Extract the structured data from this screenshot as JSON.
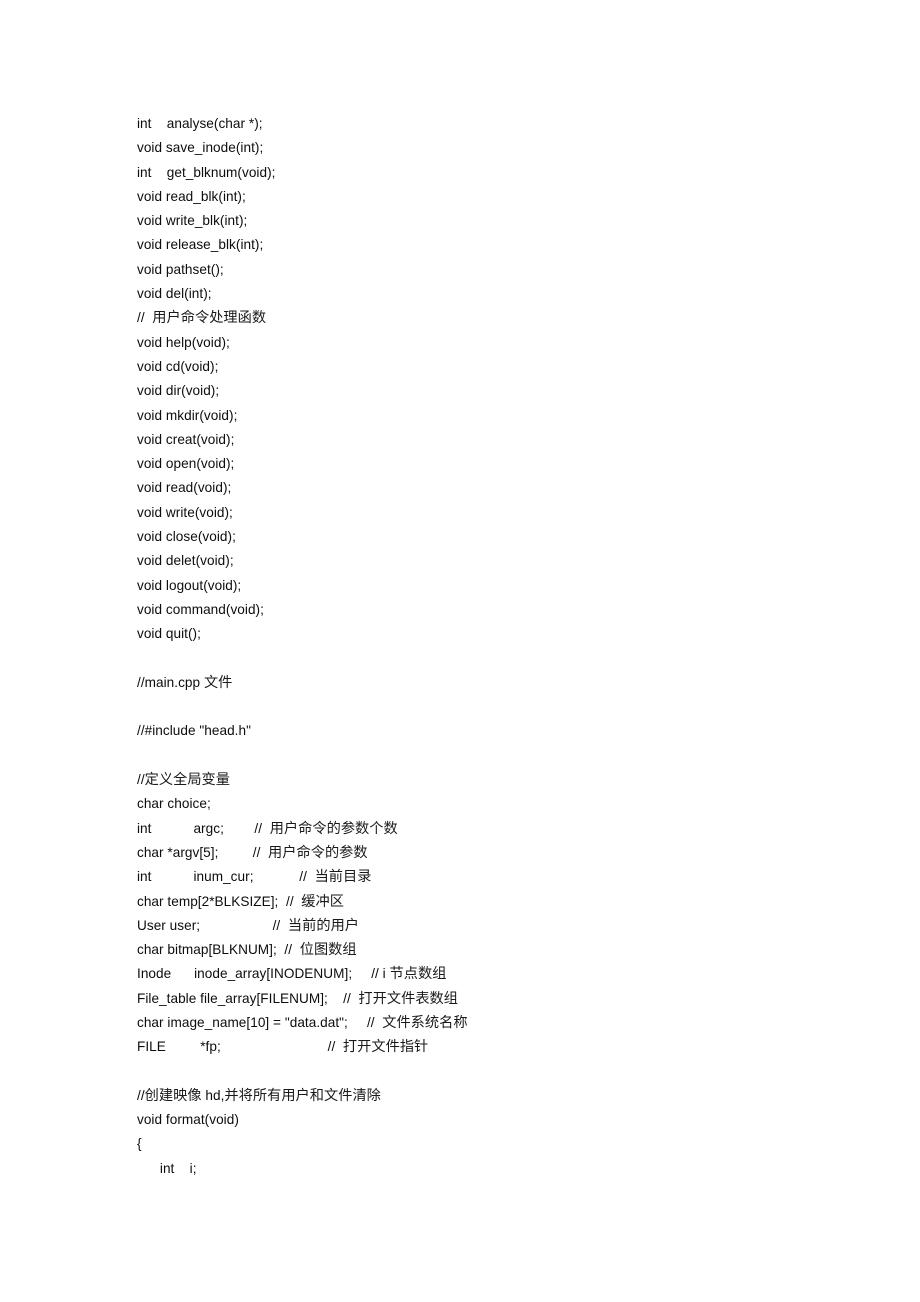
{
  "document": {
    "background_color": "#ffffff",
    "text_color": "#0d0d0d",
    "lines": [
      {
        "id": "l01",
        "text": "int    analyse(char *);"
      },
      {
        "id": "l02",
        "text": "void save_inode(int);"
      },
      {
        "id": "l03",
        "text": "int    get_blknum(void);"
      },
      {
        "id": "l04",
        "text": "void read_blk(int);"
      },
      {
        "id": "l05",
        "text": "void write_blk(int);"
      },
      {
        "id": "l06",
        "text": "void release_blk(int);"
      },
      {
        "id": "l07",
        "text": "void pathset();"
      },
      {
        "id": "l08",
        "text": "void del(int);"
      },
      {
        "id": "l09",
        "text": "//  用户命令处理函数",
        "cjk": true
      },
      {
        "id": "l10",
        "text": "void help(void);"
      },
      {
        "id": "l11",
        "text": "void cd(void);"
      },
      {
        "id": "l12",
        "text": "void dir(void);"
      },
      {
        "id": "l13",
        "text": "void mkdir(void);"
      },
      {
        "id": "l14",
        "text": "void creat(void);"
      },
      {
        "id": "l15",
        "text": "void open(void);"
      },
      {
        "id": "l16",
        "text": "void read(void);"
      },
      {
        "id": "l17",
        "text": "void write(void);"
      },
      {
        "id": "l18",
        "text": "void close(void);"
      },
      {
        "id": "l19",
        "text": "void delet(void);"
      },
      {
        "id": "l20",
        "text": "void logout(void);"
      },
      {
        "id": "l21",
        "text": "void command(void);"
      },
      {
        "id": "l22",
        "text": "void quit();"
      },
      {
        "id": "l23",
        "text": "",
        "blank": true
      },
      {
        "id": "l24",
        "text": "//main.cpp 文件",
        "cjk": true
      },
      {
        "id": "l25",
        "text": "",
        "blank": true
      },
      {
        "id": "l26",
        "text": "//#include \"head.h\""
      },
      {
        "id": "l27",
        "text": "",
        "blank": true
      },
      {
        "id": "l28",
        "text": "//定义全局变量",
        "cjk": true
      },
      {
        "id": "l29",
        "text": "char choice;"
      },
      {
        "id": "l30",
        "text": "int           argc;        //  用户命令的参数个数",
        "cjk": true
      },
      {
        "id": "l31",
        "text": "char *argv[5];         //  用户命令的参数",
        "cjk": true
      },
      {
        "id": "l32",
        "text": "int           inum_cur;            //  当前目录",
        "cjk": true
      },
      {
        "id": "l33",
        "text": "char temp[2*BLKSIZE];  //  缓冲区",
        "cjk": true
      },
      {
        "id": "l34",
        "text": "User user;                   //  当前的用户",
        "cjk": true
      },
      {
        "id": "l35",
        "text": "char bitmap[BLKNUM];  //  位图数组",
        "cjk": true
      },
      {
        "id": "l36",
        "text": "Inode      inode_array[INODENUM];     // i 节点数组",
        "cjk": true
      },
      {
        "id": "l37",
        "text": "File_table file_array[FILENUM];    //  打开文件表数组",
        "cjk": true
      },
      {
        "id": "l38",
        "text": "char image_name[10] = \"data.dat\";     //  文件系统名称",
        "cjk": true
      },
      {
        "id": "l39",
        "text": "FILE         *fp;                            //  打开文件指针",
        "cjk": true
      },
      {
        "id": "l40",
        "text": "",
        "blank": true
      },
      {
        "id": "l41",
        "text": "//创建映像 hd,并将所有用户和文件清除",
        "cjk": true
      },
      {
        "id": "l42",
        "text": "void format(void)"
      },
      {
        "id": "l43",
        "text": "{"
      },
      {
        "id": "l44",
        "text": "      int    i;"
      }
    ]
  }
}
